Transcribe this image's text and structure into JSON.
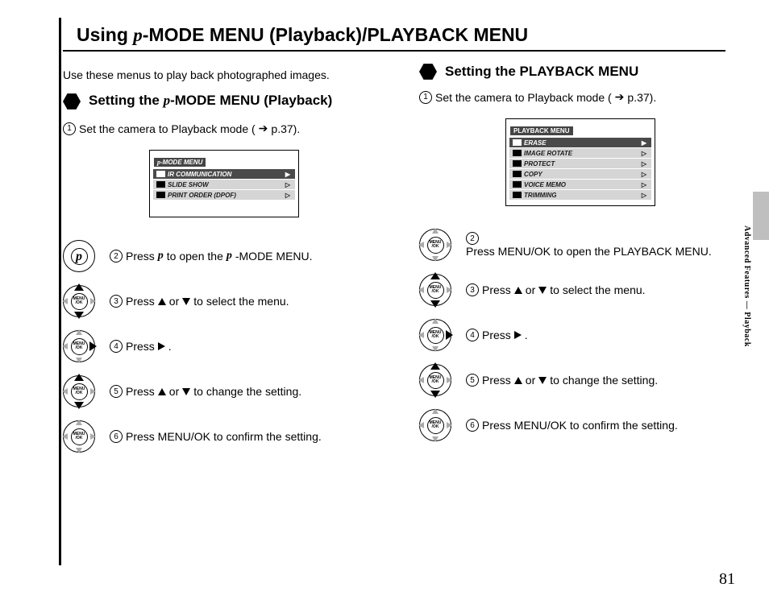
{
  "page": {
    "title_pre": "Using ",
    "title_f": "p",
    "title_post": "-MODE MENU (Playback)/PLAYBACK MENU",
    "intro": "Use these menus to play back photographed images.",
    "side_label": "Advanced Features — Playback",
    "number": "81"
  },
  "left": {
    "heading_pre": "Setting the ",
    "heading_f": "p",
    "heading_post": "-MODE MENU (Playback)",
    "lead_pre": "Set the camera to Playback mode (",
    "lead_arrow": "➔",
    "lead_post": "p.37).",
    "screen": {
      "title_f": "p",
      "title_rest": "-MODE MENU",
      "rows": [
        {
          "label": "IR COMMUNICATION",
          "highlight": true,
          "arrow": "▶"
        },
        {
          "label": "SLIDE SHOW",
          "highlight": false,
          "arrow": "▷"
        },
        {
          "label": "PRINT ORDER (DPOF)",
          "highlight": false,
          "arrow": "▷"
        }
      ]
    },
    "steps": [
      {
        "n": "2",
        "segments": [
          "Press ",
          {
            "f": "p"
          },
          " to open the ",
          {
            "f": "p"
          },
          "-MODE MENU."
        ],
        "dial": "f"
      },
      {
        "n": "3",
        "segments": [
          "Press ",
          {
            "up": true
          },
          " or ",
          {
            "down": true
          },
          " to select the menu."
        ],
        "dial": "ud-big"
      },
      {
        "n": "4",
        "segments": [
          "Press ",
          {
            "right": true
          },
          "."
        ],
        "dial": "r-big"
      },
      {
        "n": "5",
        "segments": [
          "Press ",
          {
            "up": true
          },
          " or ",
          {
            "down": true
          },
          " to change the setting."
        ],
        "dial": "ud-big"
      },
      {
        "n": "6",
        "segments": [
          "Press MENU/OK to confirm the setting."
        ],
        "dial": "plain"
      }
    ]
  },
  "right": {
    "heading": "Setting the PLAYBACK MENU",
    "lead_pre": "Set the camera to Playback mode (",
    "lead_arrow": "➔",
    "lead_post": "p.37).",
    "screen": {
      "title": "PLAYBACK MENU",
      "rows": [
        {
          "label": "ERASE",
          "highlight": true,
          "arrow": "▶"
        },
        {
          "label": "IMAGE ROTATE",
          "highlight": false,
          "arrow": "▷"
        },
        {
          "label": "PROTECT",
          "highlight": false,
          "arrow": "▷"
        },
        {
          "label": "COPY",
          "highlight": false,
          "arrow": "▷"
        },
        {
          "label": "VOICE MEMO",
          "highlight": false,
          "arrow": "▷"
        },
        {
          "label": "TRIMMING",
          "highlight": false,
          "arrow": "▷"
        }
      ]
    },
    "steps": [
      {
        "n": "2",
        "segments": [
          "Press MENU/OK to open the PLAYBACK MENU."
        ],
        "dial": "plain"
      },
      {
        "n": "3",
        "segments": [
          "Press ",
          {
            "up": true
          },
          " or ",
          {
            "down": true
          },
          " to select the menu."
        ],
        "dial": "ud-big"
      },
      {
        "n": "4",
        "segments": [
          "Press ",
          {
            "right": true
          },
          "."
        ],
        "dial": "r-big"
      },
      {
        "n": "5",
        "segments": [
          "Press ",
          {
            "up": true
          },
          " or ",
          {
            "down": true
          },
          " to change the setting."
        ],
        "dial": "ud-big"
      },
      {
        "n": "6",
        "segments": [
          "Press MENU/OK to confirm the setting."
        ],
        "dial": "plain"
      }
    ]
  }
}
